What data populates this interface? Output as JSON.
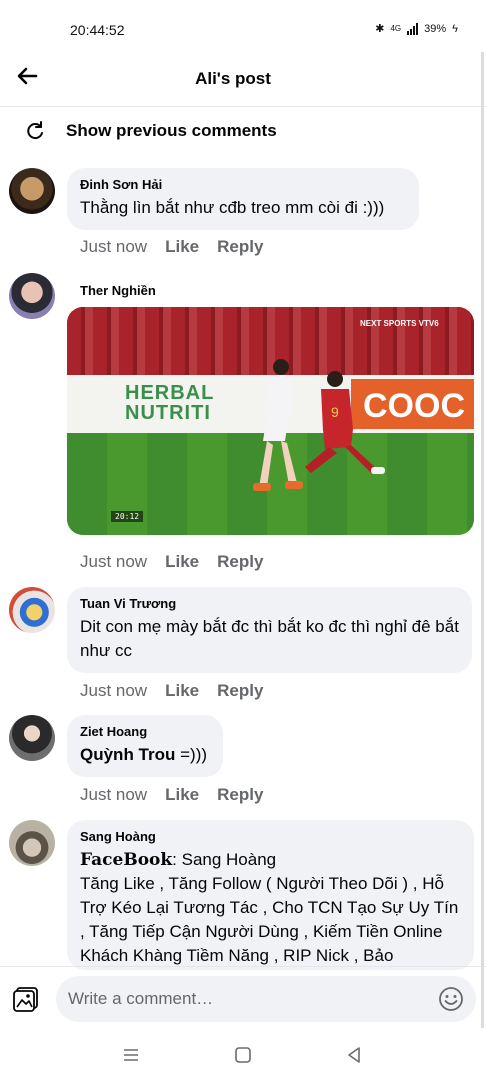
{
  "status_bar": {
    "time": "20:44:52",
    "network": "4G",
    "battery": "39%"
  },
  "header": {
    "title": "Ali's post"
  },
  "show_previous": "Show previous comments",
  "comments": [
    {
      "author": "Đinh Sơn Hải",
      "text": "Thằng lìn bắt như cđb treo mm còi đi :)))"
    },
    {
      "author": "Ther Nghiền",
      "video": {
        "logo": "NEXT SPORTS VTV6",
        "board_text": [
          "HERBAL",
          "NUTRITI"
        ],
        "board_text_right": "COOC",
        "timestamp": "20:12"
      }
    },
    {
      "author": "Tuan Vi Trương",
      "text": "Dit  con mẹ mày bắt đc thì bắt ko đc thì nghỉ đê bắt như cc"
    },
    {
      "author": "Ziet Hoang",
      "bold_part": "Quỳnh Trou",
      "text": " =)))"
    },
    {
      "author": "Sang Hoàng",
      "fb_word": "FaceBook",
      "fb_suffix": ": Sang Hoàng",
      "text": "Tăng Like , Tăng Follow ( Người Theo Dõi ) , Hỗ Trợ Kéo Lại Tương Tác , Cho TCN Tạo Sự Uy Tín , Tăng Tiếp Cận Người Dùng , Kiếm Tiền Online Khách Khàng Tiềm Năng , RIP Nick , Bảo"
    }
  ],
  "actions": {
    "time": "Just now",
    "like": "Like",
    "reply": "Reply"
  },
  "composer": {
    "placeholder": "Write a comment…"
  }
}
